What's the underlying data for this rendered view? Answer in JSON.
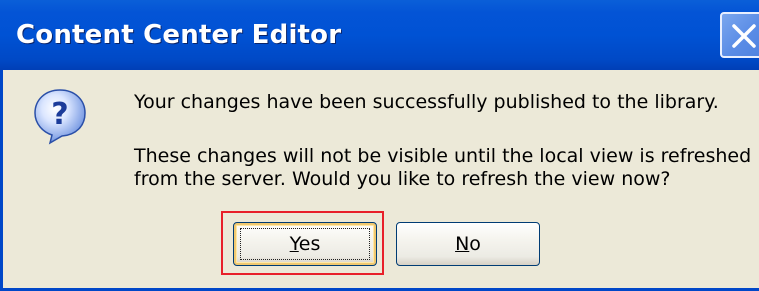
{
  "window": {
    "title": "Content Center Editor"
  },
  "message": {
    "line1": "Your changes have been successfully published to the library.",
    "line2": "These changes will not be visible until the local view is refreshed",
    "line3": "from the server. Would you like to refresh the view now?"
  },
  "icons": {
    "dialog": "question-icon",
    "close": "close-icon"
  },
  "buttons": {
    "yes": {
      "mnemonic": "Y",
      "rest": "es"
    },
    "no": {
      "mnemonic": "N",
      "rest": "o"
    }
  },
  "colors": {
    "titlebar": "#0052d4",
    "body": "#ece9d8",
    "highlight": "#e8202a"
  }
}
